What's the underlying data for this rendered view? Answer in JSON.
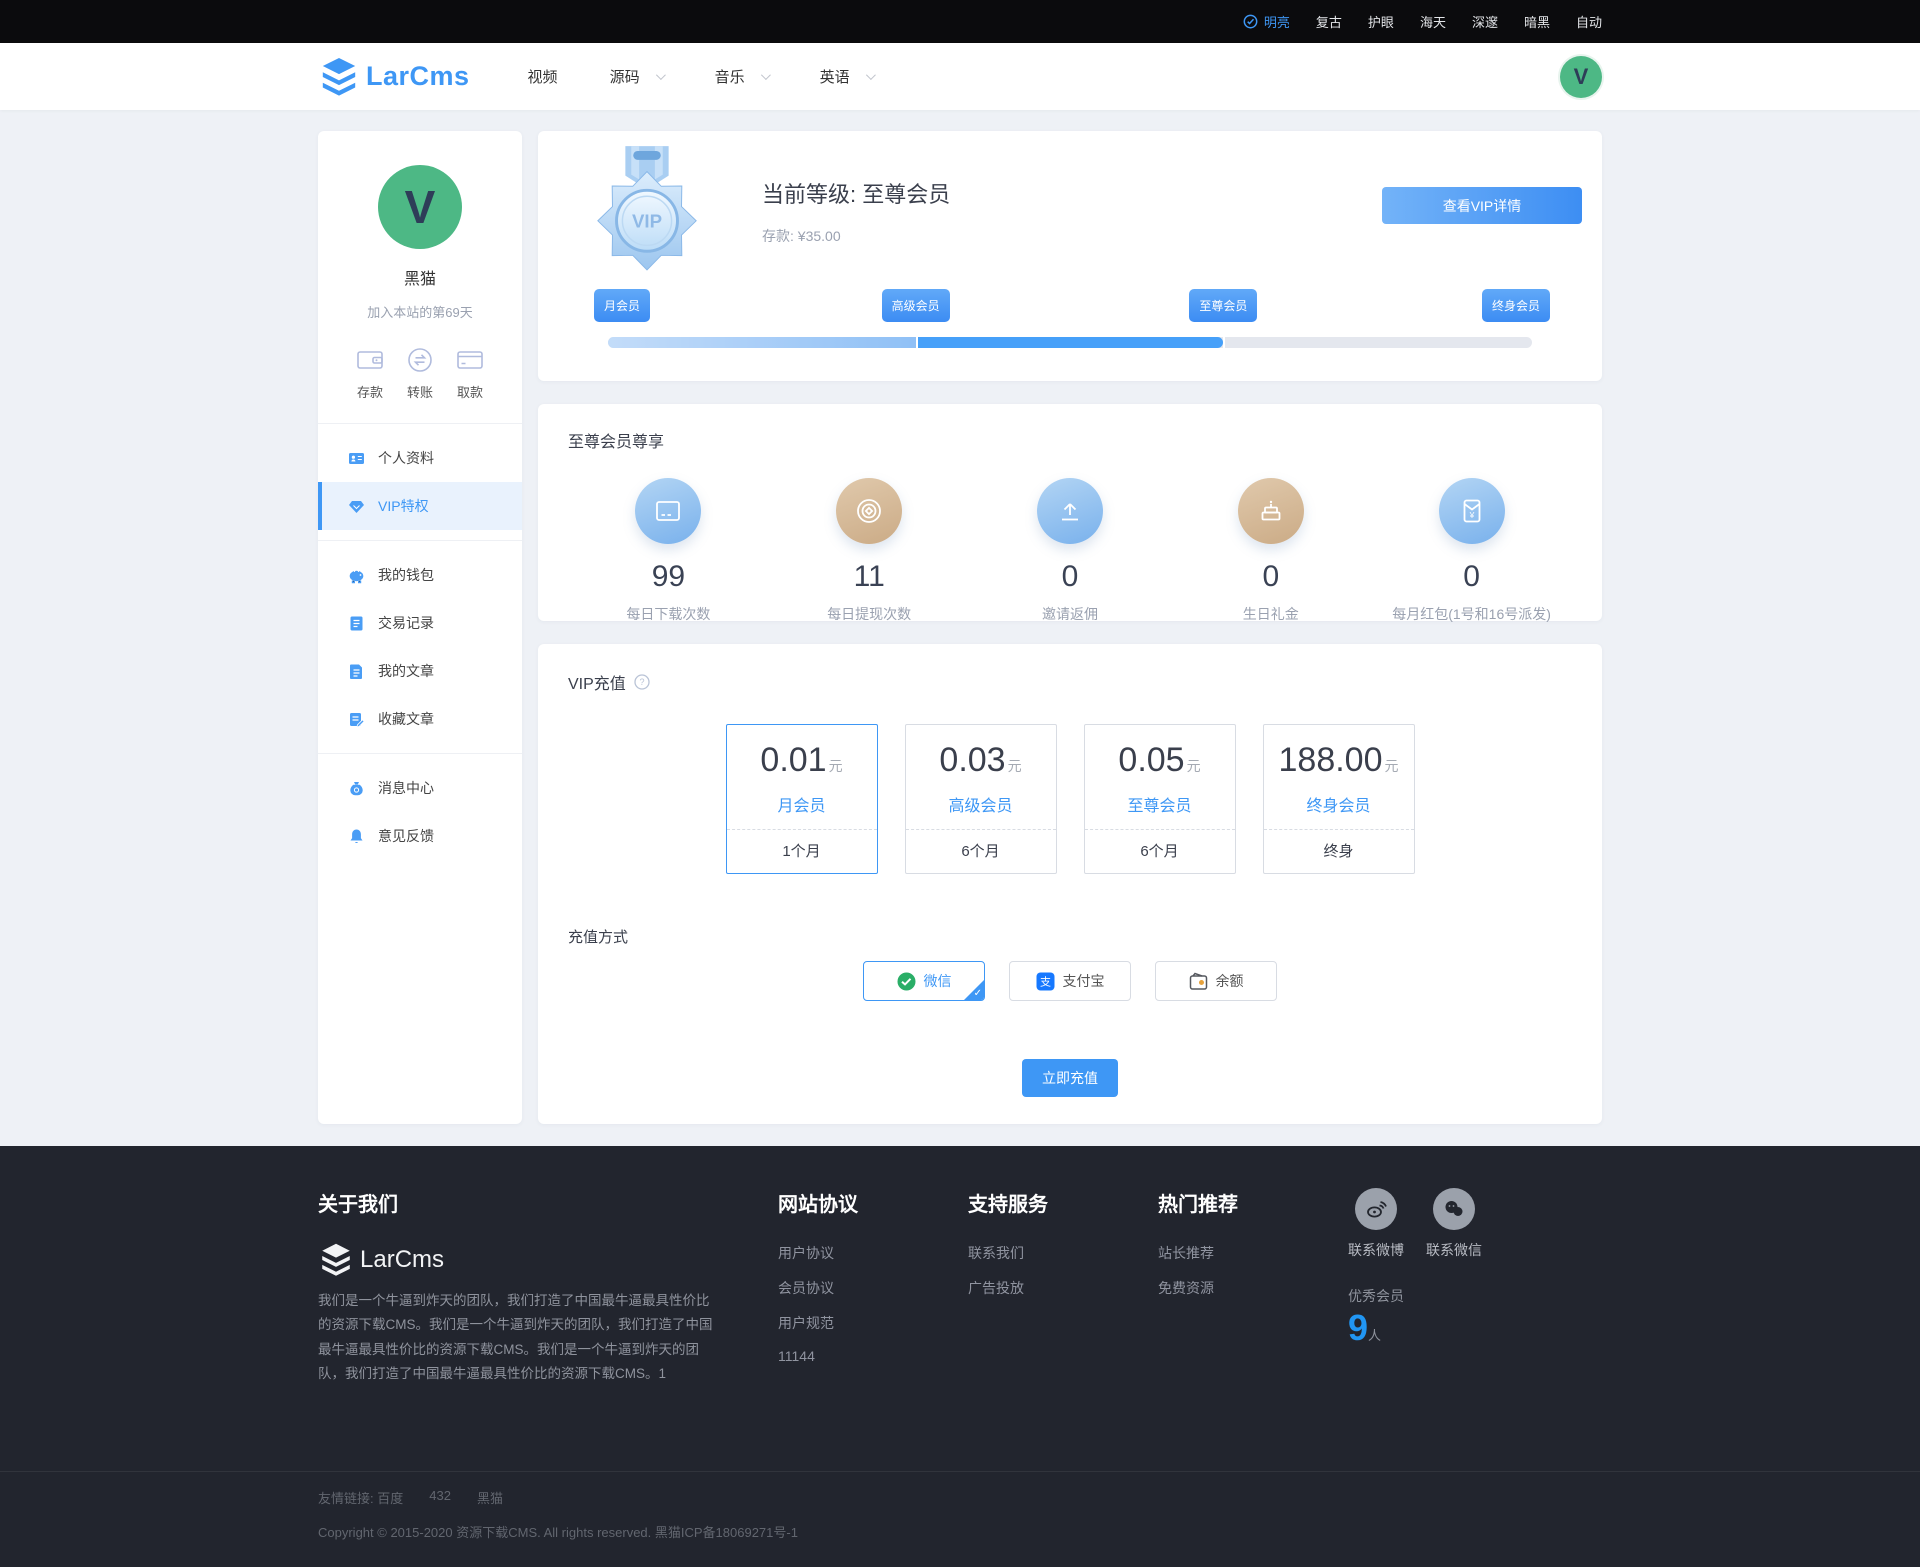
{
  "colors": {
    "accent": "#3e97f5",
    "tan": "#cbab86",
    "green": "#4db885",
    "footer_bg": "#22252e"
  },
  "topbar": {
    "themes": [
      {
        "label": "明亮",
        "active": true
      },
      {
        "label": "复古",
        "active": false
      },
      {
        "label": "护眼",
        "active": false
      },
      {
        "label": "海天",
        "active": false
      },
      {
        "label": "深邃",
        "active": false
      },
      {
        "label": "暗黑",
        "active": false
      },
      {
        "label": "自动",
        "active": false
      }
    ]
  },
  "header": {
    "brand": "LarCms",
    "nav": [
      {
        "label": "视频",
        "dropdown": false
      },
      {
        "label": "源码",
        "dropdown": true
      },
      {
        "label": "音乐",
        "dropdown": true
      },
      {
        "label": "英语",
        "dropdown": true
      }
    ],
    "avatar_letter": "V"
  },
  "sidebar": {
    "user": {
      "avatar_letter": "V",
      "name": "黑猫",
      "joined": "加入本站的第69天"
    },
    "quick_actions": [
      {
        "label": "存款",
        "icon": "wallet-icon"
      },
      {
        "label": "转账",
        "icon": "transfer-icon"
      },
      {
        "label": "取款",
        "icon": "bankcard-icon"
      }
    ],
    "menu": [
      {
        "label": "个人资料",
        "icon": "idcard-icon",
        "active": false
      },
      {
        "label": "VIP特权",
        "icon": "diamond-icon",
        "active": true
      },
      {
        "label": "我的钱包",
        "icon": "piggybank-icon",
        "active": false
      },
      {
        "label": "交易记录",
        "icon": "records-icon",
        "active": false
      },
      {
        "label": "我的文章",
        "icon": "article-icon",
        "active": false
      },
      {
        "label": "收藏文章",
        "icon": "favorite-icon",
        "active": false
      },
      {
        "label": "消息中心",
        "icon": "moneybag-icon",
        "active": false
      },
      {
        "label": "意见反馈",
        "icon": "bell-icon",
        "active": false
      }
    ]
  },
  "vip": {
    "medal_text": "VIP",
    "current_level": "当前等级: 至尊会员",
    "deposit_label": "存款:",
    "deposit_value": "¥35.00",
    "detail_button": "查看VIP详情",
    "levels": [
      "月会员",
      "高级会员",
      "至尊会员",
      "终身会员"
    ],
    "progress_percent": 66.6
  },
  "privileges": {
    "title": "至尊会员尊享",
    "items": [
      {
        "icon": "download-card-icon",
        "color": "blue",
        "value": "99",
        "label": "每日下载次数"
      },
      {
        "icon": "coin-icon",
        "color": "tan",
        "value": "11",
        "label": "每日提现次数"
      },
      {
        "icon": "upload-icon",
        "color": "blue",
        "value": "0",
        "label": "邀请返佣"
      },
      {
        "icon": "cake-icon",
        "color": "tan",
        "value": "0",
        "label": "生日礼金"
      },
      {
        "icon": "red-envelope-icon",
        "color": "blue",
        "value": "0",
        "label": "每月红包(1号和16号派发)"
      }
    ]
  },
  "recharge": {
    "title": "VIP充值",
    "plans": [
      {
        "price": "0.01",
        "unit": "元",
        "name": "月会员",
        "duration": "1个月",
        "selected": true
      },
      {
        "price": "0.03",
        "unit": "元",
        "name": "高级会员",
        "duration": "6个月",
        "selected": false
      },
      {
        "price": "0.05",
        "unit": "元",
        "name": "至尊会员",
        "duration": "6个月",
        "selected": false
      },
      {
        "price": "188.00",
        "unit": "元",
        "name": "终身会员",
        "duration": "终身",
        "selected": false
      }
    ],
    "method_label": "充值方式",
    "methods": [
      {
        "label": "微信",
        "icon": "wechat-pay-icon",
        "selected": true
      },
      {
        "label": "支付宝",
        "icon": "alipay-icon",
        "selected": false
      },
      {
        "label": "余额",
        "icon": "balance-icon",
        "selected": false
      }
    ],
    "submit_label": "立即充值"
  },
  "footer": {
    "about_title": "关于我们",
    "brand": "LarCms",
    "about_text": "我们是一个牛逼到炸天的团队，我们打造了中国最牛逼最具性价比的资源下载CMS。我们是一个牛逼到炸天的团队，我们打造了中国最牛逼最具性价比的资源下载CMS。我们是一个牛逼到炸天的团队，我们打造了中国最牛逼最具性价比的资源下载CMS。1",
    "columns": [
      {
        "title": "网站协议",
        "links": [
          "用户协议",
          "会员协议",
          "用户规范",
          "11144"
        ]
      },
      {
        "title": "支持服务",
        "links": [
          "联系我们",
          "广告投放"
        ]
      },
      {
        "title": "热门推荐",
        "links": [
          "站长推荐",
          "免费资源"
        ]
      }
    ],
    "social": [
      {
        "label": "联系微博",
        "icon": "weibo-icon"
      },
      {
        "label": "联系微信",
        "icon": "wechat-icon"
      }
    ],
    "members": {
      "label": "优秀会员",
      "count": "9",
      "unit": "人"
    },
    "links_line": {
      "prefix": "友情链接: 百度",
      "link2": "432",
      "link3": "黑猫"
    },
    "copyright": "Copyright © 2015-2020 资源下载CMS. All rights reserved. 黑猫ICP备18069271号-1"
  }
}
